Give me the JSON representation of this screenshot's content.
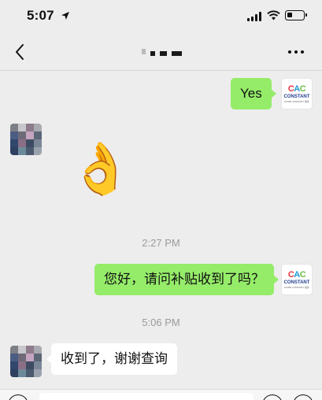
{
  "status_bar": {
    "time": "5:07",
    "icons": [
      "location-arrow-icon",
      "cellular-signal-icon",
      "wifi-icon",
      "battery-icon"
    ]
  },
  "nav": {
    "back_icon": "chevron-left-icon",
    "more_icon": "ellipsis-icon"
  },
  "messages": [
    {
      "sender": "me",
      "type": "text",
      "text": "Yes"
    },
    {
      "sender": "them",
      "type": "sticker",
      "sticker": "ok-hand-emoji",
      "glyph": "👌"
    },
    {
      "type": "timestamp",
      "text": "2:27 PM"
    },
    {
      "sender": "me",
      "type": "text",
      "text": "您好，请问补贴收到了吗？"
    },
    {
      "type": "timestamp",
      "text": "5:06 PM"
    },
    {
      "sender": "them",
      "type": "text",
      "text": "收到了，谢谢查询"
    }
  ],
  "brand_avatar": {
    "mark": [
      "C",
      "A",
      "C"
    ],
    "name": "CONSTANT",
    "sub": "HOME COMFORT 恒泰"
  },
  "colors": {
    "background": "#ededed",
    "outgoing_bubble": "#95ec69",
    "incoming_bubble": "#ffffff",
    "timestamp_text": "#9b9b9b"
  }
}
